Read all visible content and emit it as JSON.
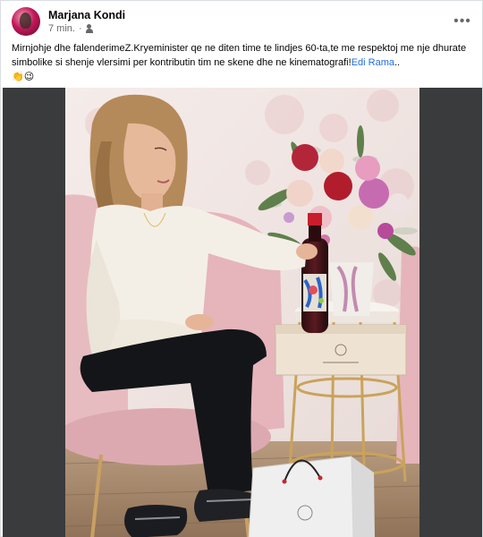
{
  "post": {
    "author": "Marjana Kondi",
    "time": "7 min.",
    "separator": "·",
    "audience_icon": "friends-icon",
    "more_icon": "more-options-icon",
    "more_label": "•••",
    "caption_text": "Mirnjohje dhe falenderimeZ.Kryeminister qe ne diten time te lindjes 60-ta,te me respektoj me nje dhurate simbolike si shenje vlersimi per kontributin tim ne skene dhe ne kinematografi!",
    "caption_link": "Edi Rama",
    "caption_suffix": "..",
    "emojis": "👏😉"
  },
  "colors": {
    "link": "#216fdb",
    "secondary_text": "#65676b",
    "media_background": "#3a3b3c"
  }
}
